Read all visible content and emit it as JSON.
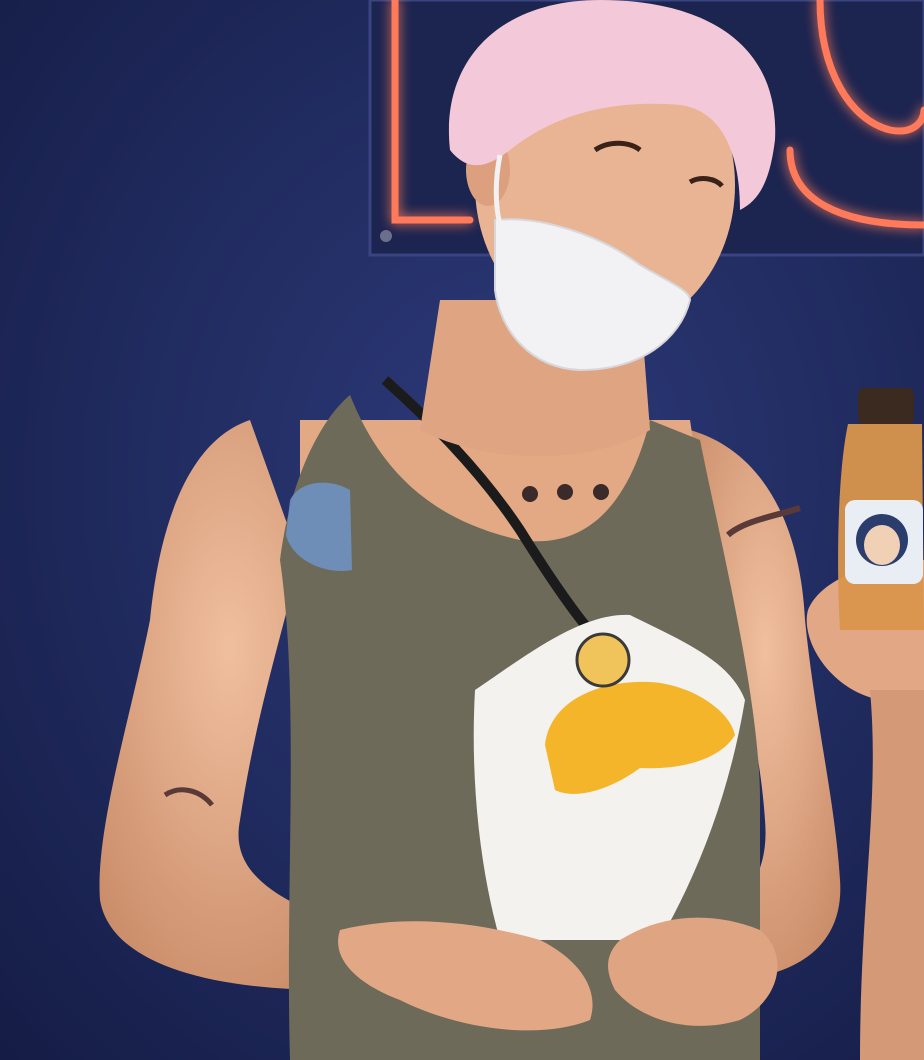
{
  "photo": {
    "colors": {
      "wall": "#24306a",
      "wall_dark": "#141c44",
      "neon": "#ff7a5a",
      "neon_glow": "#ff4f6a",
      "hair": "#f3c8d8",
      "skin": "#e8b08e",
      "skin_shadow": "#c98b68",
      "tank_top": "#6e6a5a",
      "mask": "#f2f2f4",
      "wrapper": "#f4f2ee",
      "crepe_filling": "#f5b52a",
      "bottle_liquid": "#d9954c",
      "strap": "#1b1b1b"
    }
  }
}
